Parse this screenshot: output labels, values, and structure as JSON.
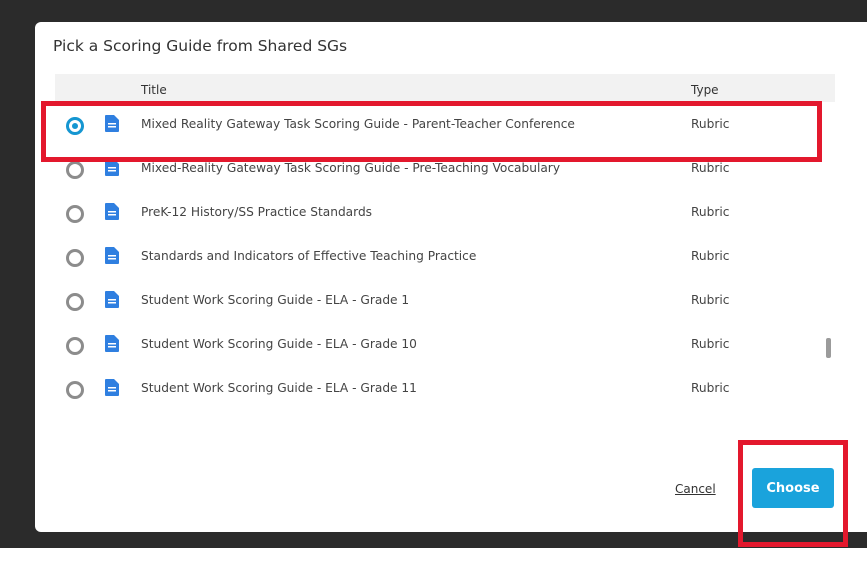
{
  "dialog": {
    "title": "Pick a Scoring Guide from Shared SGs",
    "columns": {
      "title": "Title",
      "type": "Type"
    },
    "rows": [
      {
        "title": "Mixed Reality Gateway Task Scoring Guide - Parent-Teacher Conference",
        "type": "Rubric",
        "selected": true
      },
      {
        "title": "Mixed-Reality Gateway Task Scoring Guide - Pre-Teaching Vocabulary",
        "type": "Rubric",
        "selected": false
      },
      {
        "title": "PreK-12 History/SS Practice Standards",
        "type": "Rubric",
        "selected": false
      },
      {
        "title": "Standards and Indicators of Effective Teaching Practice",
        "type": "Rubric",
        "selected": false
      },
      {
        "title": "Student Work Scoring Guide - ELA - Grade 1",
        "type": "Rubric",
        "selected": false
      },
      {
        "title": "Student Work Scoring Guide - ELA - Grade 10",
        "type": "Rubric",
        "selected": false
      },
      {
        "title": "Student Work Scoring Guide - ELA - Grade 11",
        "type": "Rubric",
        "selected": false
      }
    ],
    "cancel_label": "Cancel",
    "choose_label": "Choose"
  },
  "colors": {
    "accent": "#1aa3dc",
    "doc_icon": "#2f7fe0",
    "highlight": "#e3182d"
  },
  "icons": {
    "row_icon": "document-icon"
  }
}
